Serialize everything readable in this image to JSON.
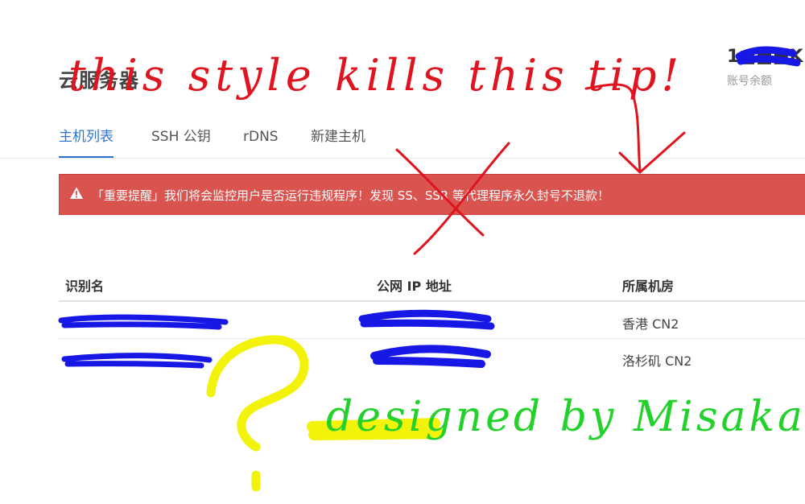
{
  "header": {
    "title": "云服务器",
    "balance_value": "1■■■K",
    "balance_label": "账号余额"
  },
  "tabs": [
    {
      "label": "主机列表",
      "active": true
    },
    {
      "label": "SSH 公钥",
      "active": false
    },
    {
      "label": "rDNS",
      "active": false
    },
    {
      "label": "新建主机",
      "active": false
    }
  ],
  "alert": {
    "icon": "warning-icon",
    "text": "「重要提醒」我们将会监控用户是否运行违规程序！发现 SS、SSR 等代理程序永久封号不退款！",
    "color": "#d9534f"
  },
  "table": {
    "columns": [
      "识别名",
      "公网 IP 地址",
      "所属机房"
    ],
    "rows": [
      {
        "name": "",
        "ip": "",
        "datacenter": "香港 CN2"
      },
      {
        "name": "",
        "ip": "",
        "datacenter": "洛杉矶 CN2"
      }
    ]
  },
  "annotations": {
    "red_note": "this style kills this tip!",
    "green_note": "designed by Misaka",
    "question_mark": "?"
  },
  "colors": {
    "accent": "#2f74d0",
    "alert_bg": "#d9534f",
    "scribble_blue": "#1717e6",
    "ink_red": "#e0141e",
    "ink_green": "#22d12a",
    "ink_yellow": "#f2f20a"
  }
}
